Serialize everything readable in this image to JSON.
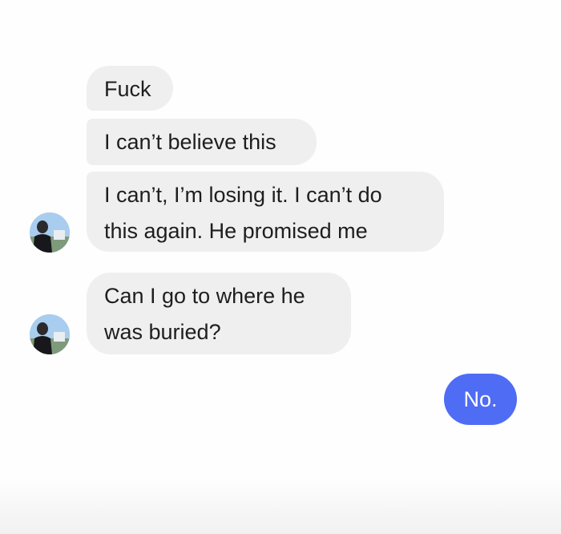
{
  "conversation": {
    "messages": [
      {
        "direction": "incoming",
        "lines": [
          "Fuck"
        ]
      },
      {
        "direction": "incoming",
        "lines": [
          "I can’t believe this"
        ]
      },
      {
        "direction": "incoming",
        "lines": [
          "I can’t, I’m losing it. I can’t do",
          "this again. He promised me"
        ],
        "avatar": "person-avatar-icon"
      },
      {
        "direction": "incoming",
        "lines": [
          "Can I go to where he",
          "was buried?"
        ],
        "avatar": "person-avatar-icon"
      },
      {
        "direction": "outgoing",
        "lines": [
          "No."
        ]
      }
    ]
  },
  "colors": {
    "incoming_bubble": "#efefef",
    "outgoing_bubble": "#4f6cf5",
    "incoming_text": "#1e1e1e",
    "outgoing_text": "#ffffff"
  }
}
